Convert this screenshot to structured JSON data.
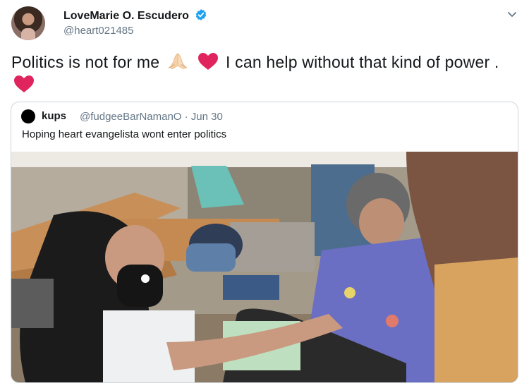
{
  "author": {
    "display_name": "LoveMarie O. Escudero",
    "handle": "@heart021485",
    "verified": true,
    "verified_color": "#1da1f2"
  },
  "tweet": {
    "text_part1": "Politics is not for me",
    "text_part2": "I can help without that kind of power .",
    "emojis": [
      "folded-hands",
      "red-heart",
      "red-heart"
    ]
  },
  "quoted_tweet": {
    "display_name": "kups",
    "handle": "@fudgeeBarNamanO · Jun 30",
    "text": "Hoping heart evangelista wont enter politics",
    "media": "photo"
  },
  "colors": {
    "text": "#14171a",
    "muted": "#657786",
    "border": "#ccd6dd",
    "heart": "#e0245e"
  }
}
